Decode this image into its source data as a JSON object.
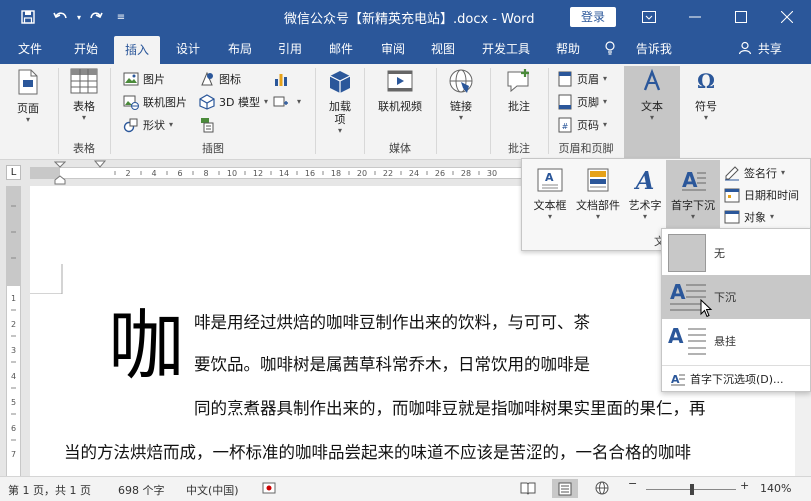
{
  "titlebar": {
    "title": "微信公众号【新精英充电站】.docx - Word",
    "login": "登录"
  },
  "tabs": [
    "文件",
    "开始",
    "插入",
    "设计",
    "布局",
    "引用",
    "邮件",
    "审阅",
    "视图",
    "开发工具",
    "帮助",
    "告诉我",
    "共享"
  ],
  "ribbon": {
    "pages": {
      "label": "页面"
    },
    "tables": {
      "btn": "表格",
      "group": "表格"
    },
    "illustrations": {
      "group": "插图",
      "picture": "图片",
      "online_picture": "联机图片",
      "shapes": "形状",
      "icons": "图标",
      "model3d": "3D 模型"
    },
    "addins": {
      "label": "加载\n项"
    },
    "media": {
      "btn": "联机视频",
      "group": "媒体"
    },
    "links": {
      "btn": "链接"
    },
    "comments": {
      "btn": "批注",
      "group": "批注"
    },
    "header_footer": {
      "header": "页眉",
      "footer": "页脚",
      "page_number": "页码",
      "group": "页眉和页脚"
    },
    "text": {
      "btn": "文本"
    },
    "symbols": {
      "btn": "符号"
    }
  },
  "text_panel": {
    "textbox": "文本框",
    "quick_parts": "文档部件",
    "wordart": "艺术字",
    "dropcap": "首字下沉",
    "signature": "签名行",
    "datetime": "日期和时间",
    "object": "对象",
    "group_char": "文"
  },
  "dropcap_menu": {
    "none": "无",
    "dropped": "下沉",
    "in_margin": "悬挂",
    "options": "首字下沉选项(D)..."
  },
  "document": {
    "dropcap_char": "咖",
    "line1": "啡是用经过烘焙的咖啡豆制作出来的饮料，与可可、茶",
    "line2": "要饮品。咖啡树是属茜草科常乔木，日常饮用的咖啡是",
    "line3": "同的烹煮器具制作出来的，而咖啡豆就是指咖啡树果实里面的果仁，再",
    "line4": "当的方法烘焙而成，一杯标准的咖啡品尝起来的味道不应该是苦涩的，一名合格的咖啡"
  },
  "statusbar": {
    "page": "第 1 页，共 1 页",
    "words": "698 个字",
    "language": "中文(中国)",
    "zoom": "140%"
  },
  "colors": {
    "accent": "#2b579a",
    "selected_bg": "#c6c6c6",
    "hover_bg": "#c8c8c8"
  }
}
